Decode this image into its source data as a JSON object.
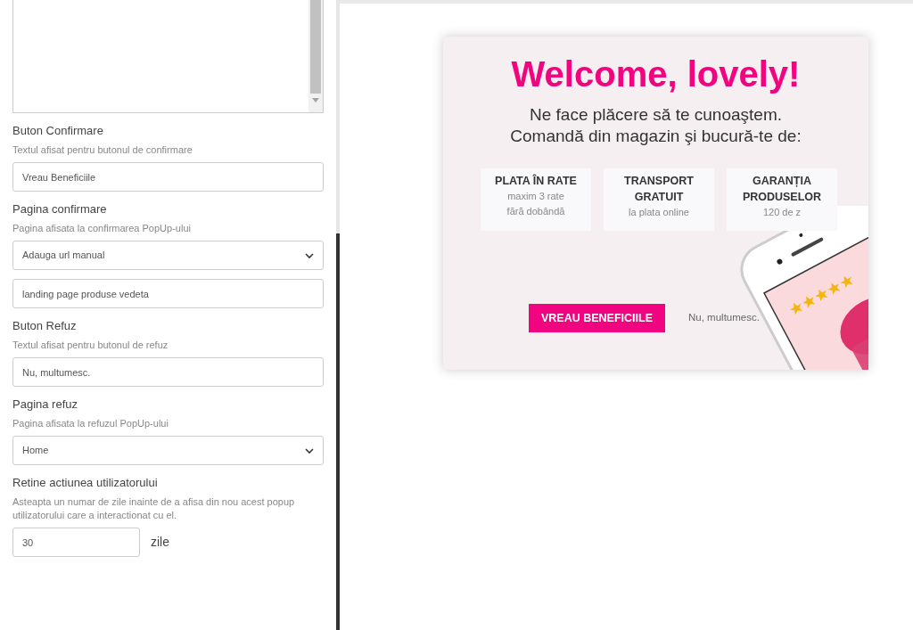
{
  "settings": [
    {
      "kind": "text",
      "label": "Buton Confirmare",
      "hint": "Textul afisat pentru butonul de confirmare",
      "value": "Vreau Beneficiile"
    },
    {
      "kind": "select",
      "label": "Pagina confirmare",
      "hint": "Pagina afisata la confirmarea PopUp-ului",
      "value": "Adauga url manual",
      "extra_value": "landing page produse vedeta"
    },
    {
      "kind": "text",
      "label": "Buton Refuz",
      "hint": "Textul afisat pentru butonul de refuz",
      "value": "Nu, multumesc."
    },
    {
      "kind": "select",
      "label": "Pagina refuz",
      "hint": "Pagina afisata la refuzul PopUp-ului",
      "value": "Home"
    },
    {
      "kind": "days",
      "label": "Retine actiunea utilizatorului",
      "hint": "Asteapta un numar de zile inainte de a afisa din nou acest popup utilizatorului care a interactionat cu el.",
      "value": "30",
      "unit": "zile"
    }
  ],
  "popup": {
    "title": "Welcome, lovely!",
    "subtitle": [
      "Ne face plăcere să te cunoaştem.",
      "Comandă din magazin şi bucură-te de:"
    ],
    "benefits": [
      {
        "title": "PLATA ÎN RATE",
        "lines": [
          "maxim 3 rate",
          "fără dobândă"
        ]
      },
      {
        "title": "TRANSPORT GRATUIT",
        "lines": [
          "la plata online"
        ]
      },
      {
        "title": "GARANȚIA PRODUSELOR",
        "lines": [
          "120 de z"
        ]
      }
    ],
    "confirm": "VREAU BENEFICIILE",
    "decline": "Nu, multumesc."
  }
}
